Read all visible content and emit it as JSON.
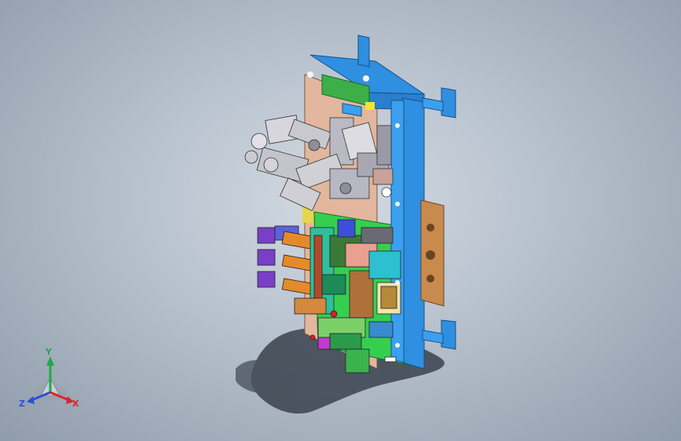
{
  "viewport": {
    "background_top": "#d3dae3",
    "background_bottom": "#8f9caa"
  },
  "model": {
    "colors": {
      "blue_frame": "#2e8fe0",
      "tan_plate": "#e0b59a",
      "green_plate": "#2ed14a",
      "grey_parts": "#c9c9cf",
      "purple_parts": "#7a3fc8",
      "orange_parts": "#e58a2a",
      "shadow": "#3c4450"
    }
  },
  "triad": {
    "y_label": "Y",
    "z_label": "Z",
    "x_label": "X",
    "y_color": "#1fa84a",
    "z_color": "#2a4fd8",
    "x_color": "#d8262a"
  }
}
